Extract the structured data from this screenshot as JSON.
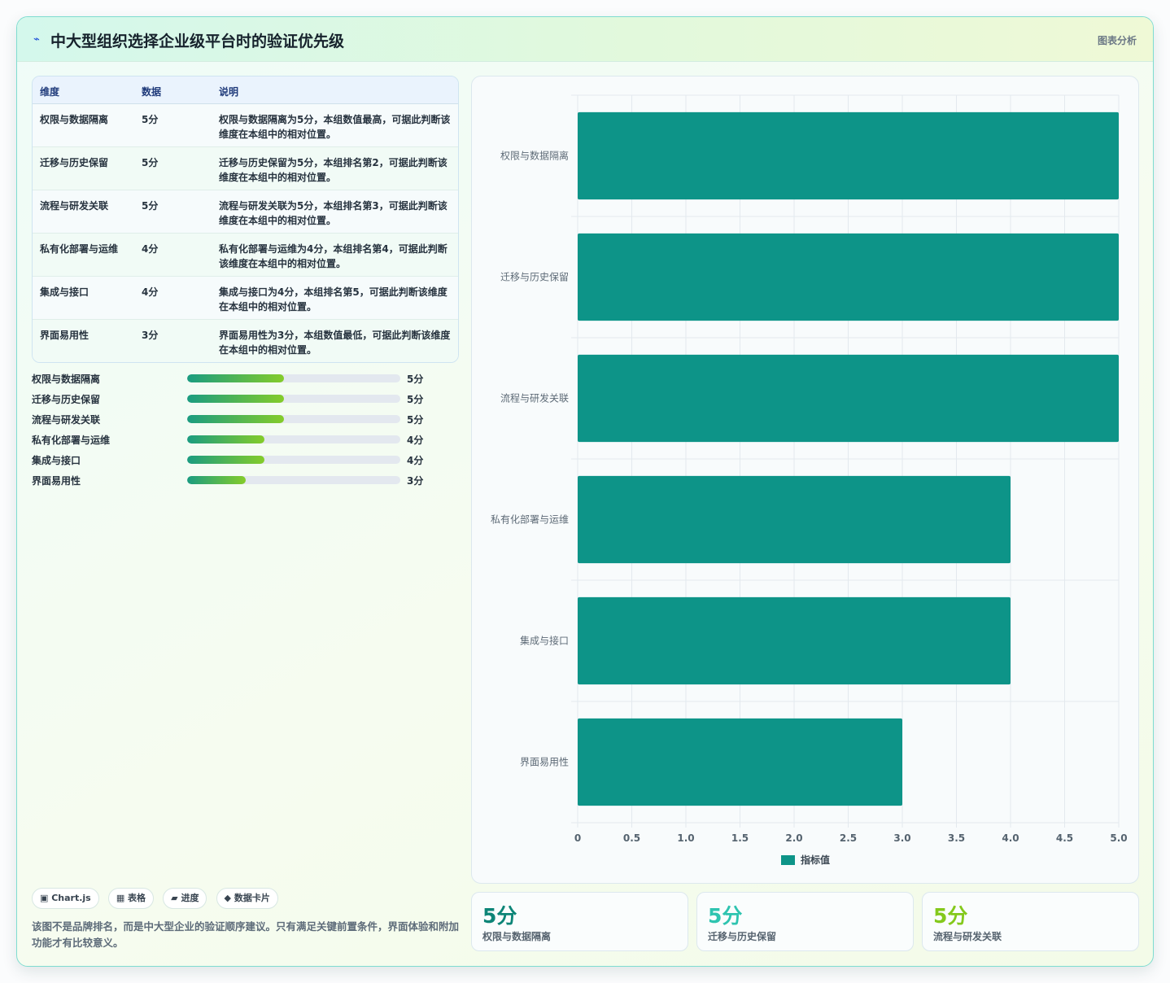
{
  "header": {
    "logo": "⌁",
    "title": "中大型组织选择企业级平台时的验证优先级",
    "tag": "图表分析"
  },
  "table": {
    "headers": [
      "维度",
      "数据",
      "说明"
    ],
    "rows": [
      {
        "name": "权限与数据隔离",
        "value": "5分",
        "desc": "权限与数据隔离为5分，本组数值最高，可据此判断该维度在本组中的相对位置。"
      },
      {
        "name": "迁移与历史保留",
        "value": "5分",
        "desc": "迁移与历史保留为5分，本组排名第2，可据此判断该维度在本组中的相对位置。"
      },
      {
        "name": "流程与研发关联",
        "value": "5分",
        "desc": "流程与研发关联为5分，本组排名第3，可据此判断该维度在本组中的相对位置。"
      },
      {
        "name": "私有化部署与运维",
        "value": "4分",
        "desc": "私有化部署与运维为4分，本组排名第4，可据此判断该维度在本组中的相对位置。"
      },
      {
        "name": "集成与接口",
        "value": "4分",
        "desc": "集成与接口为4分，本组排名第5，可据此判断该维度在本组中的相对位置。"
      },
      {
        "name": "界面易用性",
        "value": "3分",
        "desc": "界面易用性为3分，本组数值最低，可据此判断该维度在本组中的相对位置。"
      }
    ]
  },
  "progress": [
    {
      "label": "权限与数据隔离",
      "value": "5分",
      "fraction": 0.455
    },
    {
      "label": "迁移与历史保留",
      "value": "5分",
      "fraction": 0.455
    },
    {
      "label": "流程与研发关联",
      "value": "5分",
      "fraction": 0.455
    },
    {
      "label": "私有化部署与运维",
      "value": "4分",
      "fraction": 0.364
    },
    {
      "label": "集成与接口",
      "value": "4分",
      "fraction": 0.364
    },
    {
      "label": "界面易用性",
      "value": "3分",
      "fraction": 0.273
    }
  ],
  "pills": [
    "▣ Chart.js",
    "▦ 表格",
    "▰ 进度",
    "◆ 数据卡片"
  ],
  "note": "该图不是品牌排名，而是中大型企业的验证顺序建议。只有满足关键前置条件，界面体验和附加功能才有比较意义。",
  "kpis": [
    {
      "value": "5分",
      "label": "权限与数据隔离",
      "color": "#0d8577"
    },
    {
      "value": "5分",
      "label": "迁移与历史保留",
      "color": "#2ec4b0"
    },
    {
      "value": "5分",
      "label": "流程与研发关联",
      "color": "#84c91c"
    }
  ],
  "chart_data": {
    "type": "bar",
    "orientation": "horizontal",
    "categories": [
      "权限与数据隔离",
      "迁移与历史保留",
      "流程与研发关联",
      "私有化部署与运维",
      "集成与接口",
      "界面易用性"
    ],
    "series": [
      {
        "name": "指标值",
        "values": [
          5,
          5,
          5,
          4,
          4,
          3
        ],
        "color": "#0d9488"
      }
    ],
    "xlim": [
      0,
      5
    ],
    "xticks": [
      "0",
      "0.5",
      "1.0",
      "1.5",
      "2.0",
      "2.5",
      "3.0",
      "3.5",
      "4.0",
      "4.5",
      "5.0"
    ],
    "grid": true,
    "legend": "bottom"
  }
}
